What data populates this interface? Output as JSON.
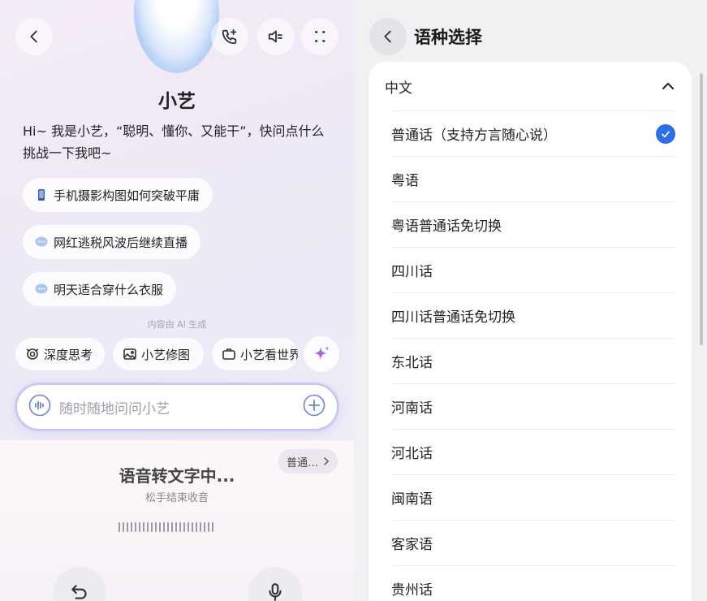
{
  "left": {
    "assistant_name": "小艺",
    "greeting": "Hi~ 我是小艺，“聪明、懂你、又能干”，快问点什么挑战一下我吧~",
    "suggestions": [
      {
        "icon": "phone-icon",
        "text": "手机摄影构图如何突破平庸"
      },
      {
        "icon": "chat-bubble-icon",
        "text": "网红逃税风波后继续直播"
      },
      {
        "icon": "chat-bubble-icon",
        "text": "明天适合穿什么衣服"
      }
    ],
    "ai_note": "内容由 AI 生成",
    "tools": [
      {
        "icon": "deep-think-icon",
        "label": "深度思考"
      },
      {
        "icon": "image-edit-icon",
        "label": "小艺修图"
      },
      {
        "icon": "camera-icon",
        "label": "小艺看世界"
      }
    ],
    "input_placeholder": "随时随地问问小艺",
    "language_pill": "普通…",
    "listening_title": "语音转文字中...",
    "listening_subtitle": "松手结束收音",
    "waveform_bars": 24
  },
  "right": {
    "title": "语种选择",
    "section": "中文",
    "selected_index": 0,
    "accent_color": "#2a6ff0",
    "languages": [
      "普通话（支持方言随心说）",
      "粤语",
      "粤语普通话免切换",
      "四川话",
      "四川话普通话免切换",
      "东北话",
      "河南话",
      "河北话",
      "闽南语",
      "客家语",
      "贵州话"
    ]
  }
}
